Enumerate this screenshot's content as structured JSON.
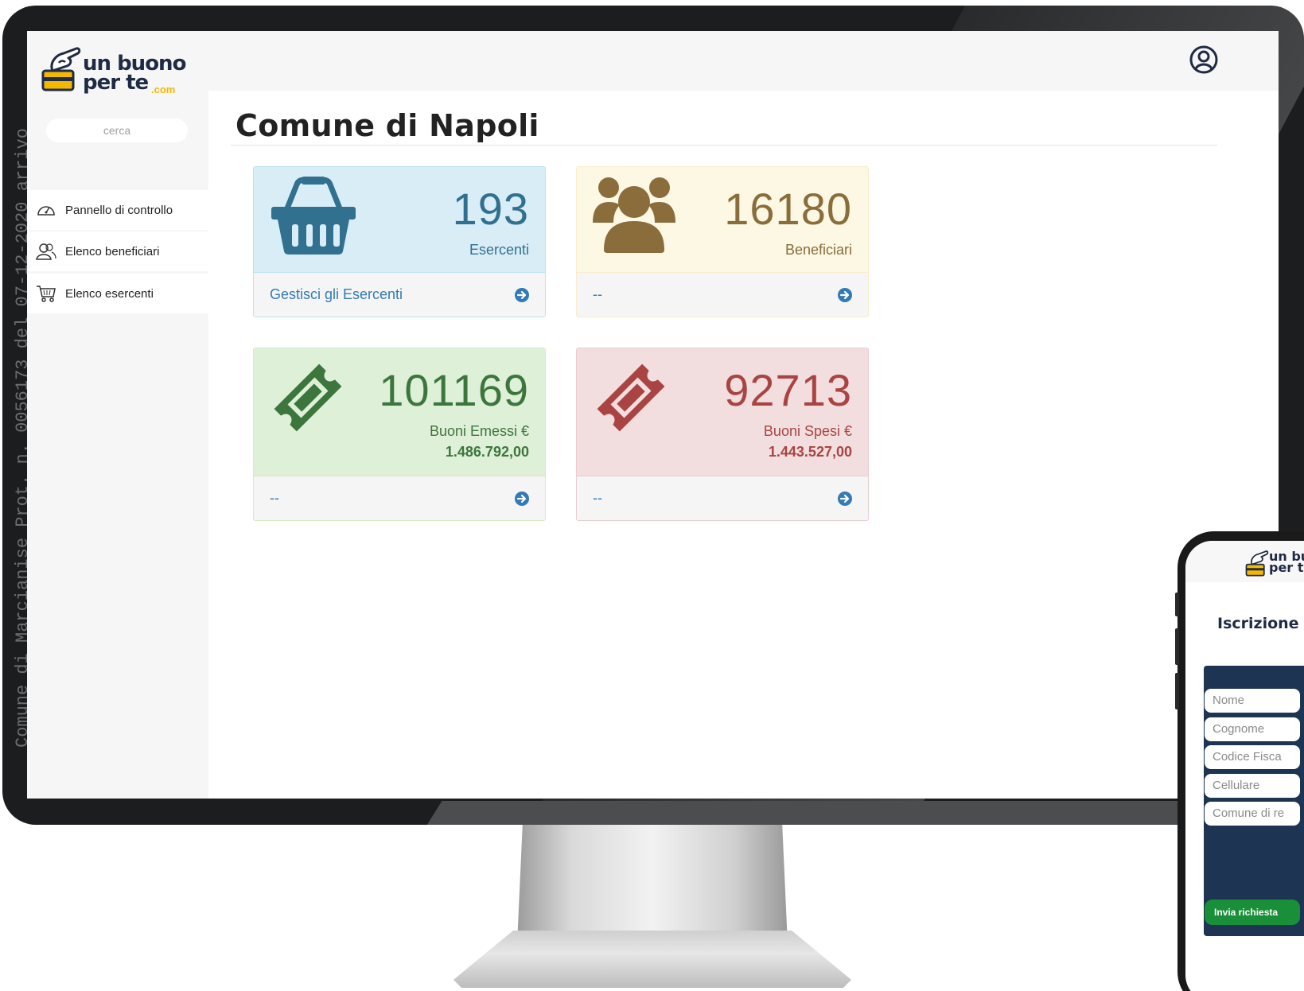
{
  "app": {
    "logo_line1": "un buono",
    "logo_line2": "per te",
    "logo_suffix": ".com"
  },
  "sidebar": {
    "search_placeholder": "cerca",
    "items": [
      {
        "label": "Pannello di controllo",
        "icon": "dashboard-icon"
      },
      {
        "label": "Elenco beneficiari",
        "icon": "users-icon"
      },
      {
        "label": "Elenco esercenti",
        "icon": "cart-icon"
      }
    ]
  },
  "watermark": "Comune di Marcianise Prot. n. 0056173 del 07-12-2020 arrivo",
  "page": {
    "title": "Comune di Napoli"
  },
  "panels": [
    {
      "value": "193",
      "label": "Esercenti",
      "footer": "Gestisci gli Esercenti",
      "icon": "basket-icon",
      "color": "#31708f"
    },
    {
      "value": "16180",
      "label": "Beneficiari",
      "footer": "--",
      "icon": "users-group-icon",
      "color": "#8a6d3b"
    },
    {
      "value": "101169",
      "label": "Buoni Emessi €",
      "amount": "1.486.792,00",
      "footer": "--",
      "icon": "ticket-icon",
      "color": "#3c763d"
    },
    {
      "value": "92713",
      "label": "Buoni Spesi €",
      "amount": "1.443.527,00",
      "footer": "--",
      "icon": "ticket-icon",
      "color": "#a94442"
    }
  ],
  "phone": {
    "heading": "Iscrizione C",
    "fields": [
      "Nome",
      "Cognome",
      "Codice Fisca",
      "Cellulare",
      "Comune di re"
    ],
    "submit": "Invia richiesta"
  },
  "colors": {
    "accent_blue": "#337ab7",
    "logo_yellow": "#f5b800",
    "logo_navy": "#1f2a44",
    "form_navy": "#1d3452",
    "submit_green": "#1a8f3a"
  }
}
